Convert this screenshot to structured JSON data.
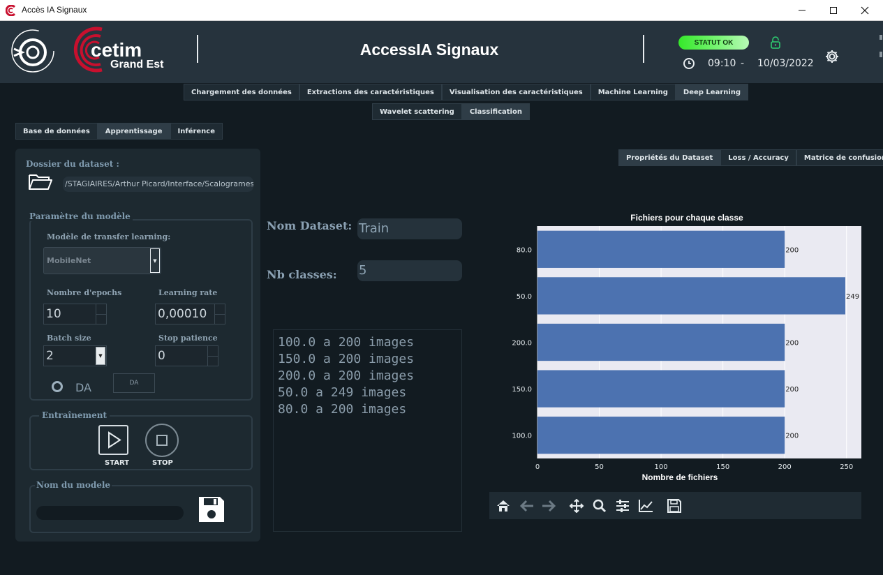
{
  "window": {
    "title": "Accès IA Signaux"
  },
  "header": {
    "app_title": "AccessIA Signaux",
    "status": "STATUT OK",
    "time": "09:10",
    "separator": "-",
    "date": "10/03/2022",
    "logo_text_1": "cetim",
    "logo_text_2": "Grand Est"
  },
  "main_tabs": [
    {
      "label": "Chargement des données"
    },
    {
      "label": "Extractions des caractéristiques"
    },
    {
      "label": "Visualisation des caractéristiques"
    },
    {
      "label": "Machine Learning"
    },
    {
      "label": "Deep Learning",
      "active": true
    }
  ],
  "sub_tabs": [
    {
      "label": "Wavelet scattering"
    },
    {
      "label": "Classification",
      "active": true
    }
  ],
  "section_tabs": [
    {
      "label": "Base de données"
    },
    {
      "label": "Apprentissage",
      "active": true
    },
    {
      "label": "Inférence"
    }
  ],
  "chart_tabs": [
    {
      "label": "Propriétés du Dataset",
      "active": true
    },
    {
      "label": "Loss / Accuracy"
    },
    {
      "label": "Matrice de confusion"
    }
  ],
  "left_panel": {
    "dataset_folder_label": "Dossier du dataset :",
    "dataset_path": "/STAGIAIRES/Arthur Picard/Interface/Scalogrames/Train",
    "model_params_label": "Paramètre du modèle",
    "transfer_model_label": "Modèle de transfer learning:",
    "transfer_model_value": "MobileNet",
    "epochs_label": "Nombre d'epochs",
    "epochs_value": "10",
    "lr_label": "Learning rate",
    "lr_value": "0,00010",
    "batch_label": "Batch size",
    "batch_value": "2",
    "patience_label": "Stop patience",
    "patience_value": "0",
    "da_label": "DA",
    "da_button": "DA",
    "training_label": "Entraînement",
    "start_label": "START",
    "stop_label": "STOP",
    "model_name_label": "Nom du modele",
    "model_name_value": ""
  },
  "center": {
    "dataset_name_label": "Nom Dataset:",
    "dataset_name_value": "Train",
    "nb_classes_label": "Nb classes:",
    "nb_classes_value": "5",
    "info_lines": [
      "100.0 a 200 images",
      "150.0 a 200 images",
      "200.0 a 200 images",
      "50.0 a 249 images",
      "80.0 a 200 images"
    ]
  },
  "chart_data": {
    "type": "bar",
    "orientation": "horizontal",
    "title": "Fichiers pour chaque classe",
    "xlabel": "Nombre de fichiers",
    "ylabel": "",
    "categories": [
      "80.0",
      "50.0",
      "200.0",
      "150.0",
      "100.0"
    ],
    "values": [
      200,
      249,
      200,
      200,
      200
    ],
    "data_labels": [
      "200",
      "249",
      "200",
      "200",
      "200"
    ],
    "xlim": [
      0,
      262
    ],
    "xticks": [
      0,
      50,
      100,
      150,
      200,
      250
    ],
    "grid": true,
    "colors": {
      "bar": "#4c72b0",
      "plot_bg": "#eaeaf2",
      "grid": "#ffffff"
    }
  },
  "plot_toolbar": [
    {
      "icon": "home-icon"
    },
    {
      "icon": "back-icon"
    },
    {
      "icon": "forward-icon"
    },
    {
      "icon": "pan-icon"
    },
    {
      "icon": "zoom-icon"
    },
    {
      "icon": "configure-subplots-icon"
    },
    {
      "icon": "edit-axes-icon"
    },
    {
      "icon": "save-figure-icon"
    }
  ],
  "colors": {
    "background": "#121b21",
    "header": "#26333d",
    "status_ok": "#35e82a",
    "brand_red": "#c8102e",
    "accent_green": "#2ecc71"
  }
}
